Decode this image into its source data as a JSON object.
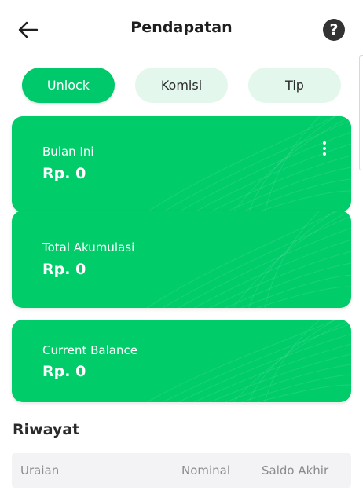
{
  "header": {
    "title": "Pendapatan",
    "back_icon": "arrow-left-icon",
    "help_icon": "question-circle-icon",
    "help_glyph": "?"
  },
  "tabs": [
    {
      "label": "Unlock",
      "active": true
    },
    {
      "label": "Komisi",
      "active": false
    },
    {
      "label": "Tip",
      "active": false
    }
  ],
  "cards": {
    "month": {
      "label": "Bulan Ini",
      "value": "Rp. 0",
      "menu_icon": "more-vertical-icon"
    },
    "total": {
      "label": "Total Akumulasi",
      "value": "Rp. 0"
    },
    "balance": {
      "label": "Current Balance",
      "value": "Rp. 0"
    }
  },
  "history": {
    "title": "Riwayat",
    "columns": [
      "Uraian",
      "Nominal",
      "Saldo Akhir"
    ]
  },
  "colors": {
    "accent": "#00c96b",
    "card": "#00cc6a",
    "tab_inactive": "#e3f7ec",
    "help_bg": "#333333",
    "table_header_bg": "#f3f3f5"
  }
}
